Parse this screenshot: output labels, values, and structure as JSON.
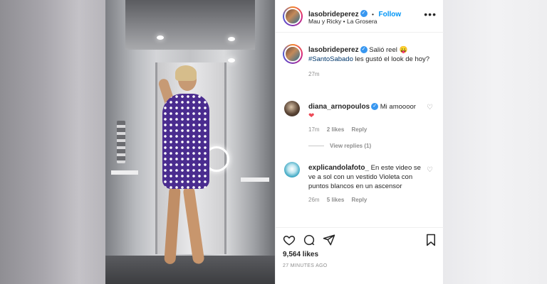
{
  "post": {
    "username": "lasobrideperez",
    "follow_label": "Follow",
    "audio": "Mau y Ricky • La Grosera",
    "caption_pre": "Salió reel 😛",
    "hashtag": "#SantoSabado",
    "caption_post": " les gustó el look de hoy?",
    "caption_time": "27m"
  },
  "comments": [
    {
      "username": "diana_arnopoulos",
      "text": "Mi amoooor",
      "time": "17m",
      "likes": "2 likes",
      "reply": "Reply",
      "view_replies": "View replies (1)"
    },
    {
      "username": "explicandolafoto_",
      "text": "En este video se ve a sol con un vestido Violeta con puntos blancos en un ascensor",
      "time": "26m",
      "likes": "5 likes",
      "reply": "Reply"
    }
  ],
  "footer": {
    "likes": "9,564 likes",
    "time_ago": "27 MINUTES AGO"
  },
  "colors": {
    "accent": "#0095f6",
    "verified": "#3897f0",
    "heart": "#ed4956",
    "dress": "#4a2c8f"
  }
}
